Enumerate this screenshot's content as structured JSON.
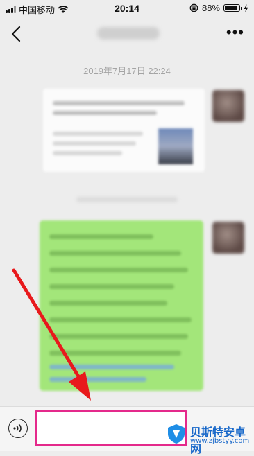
{
  "status_bar": {
    "carrier": "中国移动",
    "time": "20:14",
    "battery": "88%",
    "battery_level": 0.88,
    "icons": [
      "signal-icon",
      "wifi-icon",
      "orientation-lock-icon",
      "battery-icon",
      "charging-icon"
    ]
  },
  "nav": {
    "back_icon": "chevron-left-icon",
    "more_label": "•••"
  },
  "chat": {
    "timestamp": "2019年7月17日 22:24"
  },
  "input_bar": {
    "voice_icon": "voice-icon",
    "input_value": "",
    "highlight_color": "#e4298b"
  },
  "annotation": {
    "arrow_color": "#e8191c"
  },
  "watermark": {
    "name": "贝斯特安卓网",
    "url": "www.zjbstyy.com"
  },
  "colors": {
    "background": "#ededed",
    "outgoing_bubble": "#a3e67a",
    "incoming_bubble": "#fbfbfb"
  }
}
